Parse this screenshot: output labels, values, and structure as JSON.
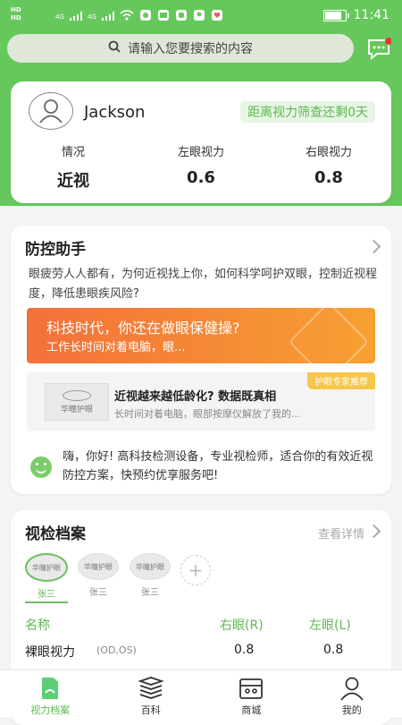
{
  "status_bar": {
    "time": "11:41",
    "hd1": "HD",
    "hd2": "HD",
    "net1": "4G",
    "net2": "4G"
  },
  "search": {
    "placeholder": "请输入您要搜索的内容"
  },
  "profile_card": {
    "username": "Jackson",
    "countdown": "距离视力筛查还剩0天",
    "stats": [
      {
        "label": "情况",
        "value": "近视"
      },
      {
        "label": "左眼视力",
        "value": "0.6"
      },
      {
        "label": "右眼视力",
        "value": "0.8"
      }
    ]
  },
  "assistant": {
    "title": "防控助手",
    "description": "眼疲劳人人都有，为何近视找上你，如何科学呵护双眼，控制近视程度，降低患眼疾风险?",
    "banner_title": "科技时代，你还在做眼保健操?",
    "banner_sub": "工作长时间对着电脑，眼...",
    "article": {
      "tag": "护眼专家推荐",
      "thumb_text": "华瞳护眼",
      "title": "近视越来越低龄化? 数据既真相",
      "subtitle": "长时间对着电脑，眼部按摩仪解放了我的..."
    },
    "greeting": "嗨，你好! 高科技检测设备，专业视检师，适合你的有效近视防控方案，快预约优享服务吧!"
  },
  "records": {
    "title": "视检档案",
    "more": "查看详情",
    "profiles": [
      {
        "name": "张三",
        "thumb": "华瞳护眼"
      },
      {
        "name": "张三",
        "thumb": "华瞳护眼"
      },
      {
        "name": "张三",
        "thumb": "华瞳护眼"
      }
    ],
    "add_symbol": "+",
    "table_header": {
      "name": "名称",
      "right": "右眼(R)",
      "left": "左眼(L)"
    },
    "rows": [
      {
        "name": "裸眼视力",
        "sub": "(OD,OS)",
        "right": "0.8",
        "left": "0.8"
      }
    ]
  },
  "nav": [
    {
      "label": "视力档案",
      "icon": "file-icon",
      "active": true
    },
    {
      "label": "百科",
      "icon": "books-icon",
      "active": false
    },
    {
      "label": "商城",
      "icon": "store-icon",
      "active": false
    },
    {
      "label": "我的",
      "icon": "person-icon",
      "active": false
    }
  ],
  "colors": {
    "brand": "#66c85c",
    "accent_text": "#5fb752",
    "banner_start": "#f3703a",
    "banner_end": "#f7a032",
    "tag": "#f7c54a"
  }
}
